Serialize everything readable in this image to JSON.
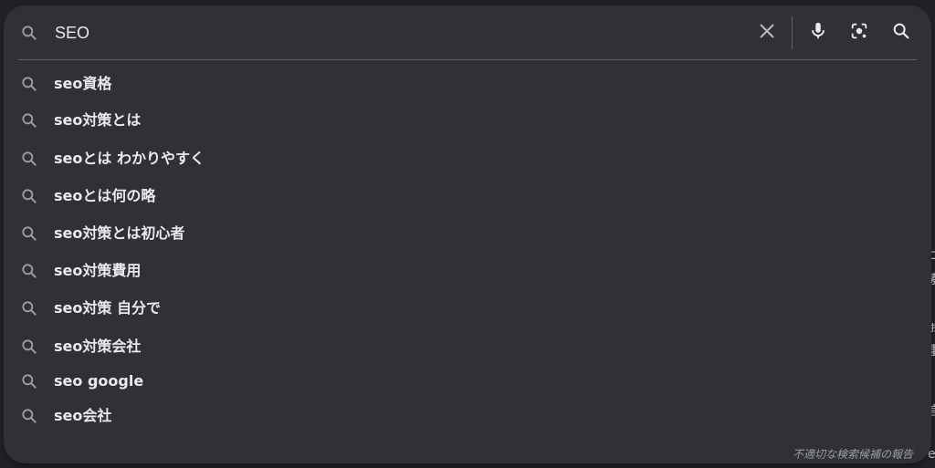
{
  "search": {
    "value": "SEO",
    "placeholder": ""
  },
  "icons": {
    "left": "search-icon",
    "clear": "close-icon",
    "voice": "microphone-icon",
    "image": "camera-lens-icon",
    "submit": "search-icon"
  },
  "suggestions": [
    "seo資格",
    "seo対策とは",
    "seoとは わかりやすく",
    "seoとは何の略",
    "seo対策とは初心者",
    "seo対策費用",
    "seo対策 自分で",
    "seo対策会社",
    "seo google",
    "seo会社"
  ],
  "footer": {
    "report": "不適切な検索候補の報告"
  },
  "colors": {
    "background": "#202124",
    "panel": "#303134",
    "text": "#e8eaed",
    "icon": "#9aa0a6",
    "divider": "#5f6368"
  }
}
